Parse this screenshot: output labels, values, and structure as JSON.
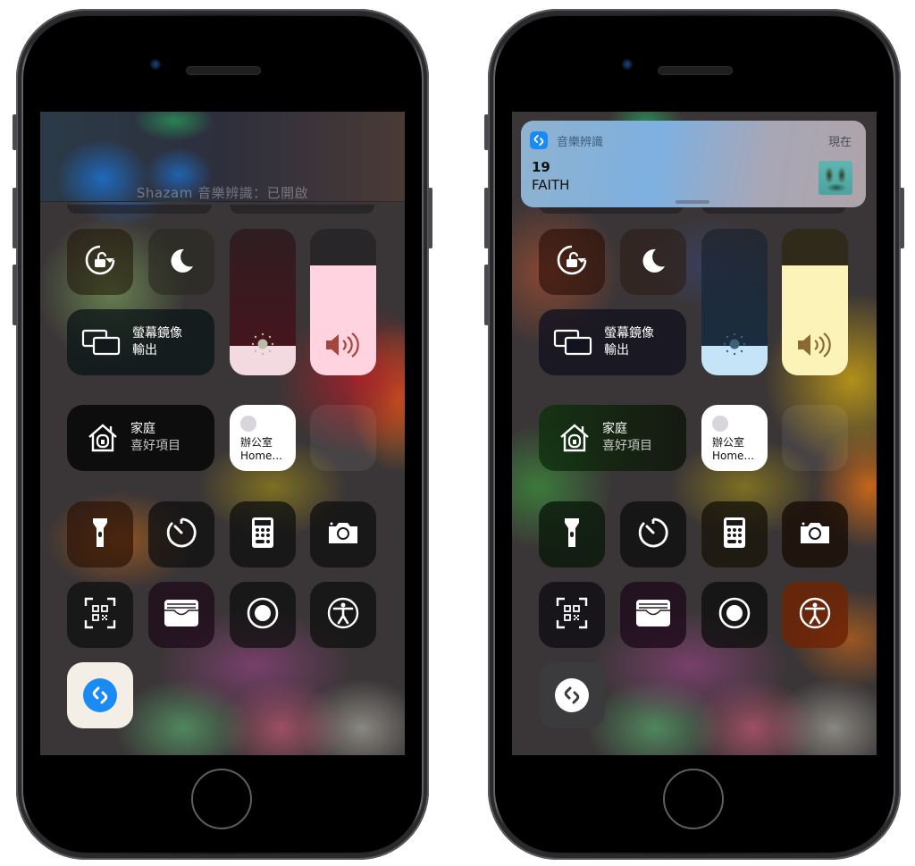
{
  "phones": [
    {
      "id": "left",
      "hud": {
        "text": "Shazam 音樂辨識：已開啟"
      },
      "screen_mirroring": {
        "line1": "螢幕鏡像",
        "line2": "輸出"
      },
      "home": {
        "line1": "家庭",
        "line2": "喜好項目"
      },
      "home_accessory": {
        "line1": "辦公室",
        "line2": "Home..."
      },
      "brightness_level": 0.2,
      "volume_level": 0.75,
      "volume_color": "#ffd3df",
      "brightness_color": "#f3d9e0",
      "shazam_tile": {
        "state": "on",
        "bg": "#f4efe6",
        "icon_color": "#1a8af5"
      },
      "accessibility_tile_active": false
    },
    {
      "id": "right",
      "notification": {
        "app_name": "音樂辨識",
        "time": "現在",
        "title": "19",
        "body": "FAITH",
        "app_icon": "shazam-icon"
      },
      "screen_mirroring": {
        "line1": "螢幕鏡像",
        "line2": "輸出"
      },
      "home": {
        "line1": "家庭",
        "line2": "喜好項目"
      },
      "home_accessory": {
        "line1": "辦公室",
        "line2": "Home..."
      },
      "brightness_level": 0.2,
      "volume_level": 0.75,
      "volume_color": "#fbf3b8",
      "brightness_color": "#c6e4f8",
      "shazam_tile": {
        "state": "off",
        "bg": "#3b3a3c",
        "icon_color": "#ffffff"
      },
      "accessibility_tile_active": true
    }
  ],
  "icons": {
    "rotation_lock": "rotation-lock-icon",
    "do_not_disturb": "moon-icon",
    "screen_mirroring": "screen-mirroring-icon",
    "brightness": "sun-icon",
    "volume": "speaker-icon",
    "home": "house-icon",
    "flashlight": "flashlight-icon",
    "timer": "timer-icon",
    "calculator": "calculator-icon",
    "camera": "camera-icon",
    "qr_scanner": "qr-code-icon",
    "wallet": "wallet-icon",
    "screen_recording": "record-icon",
    "accessibility": "accessibility-icon",
    "shazam": "shazam-icon"
  }
}
